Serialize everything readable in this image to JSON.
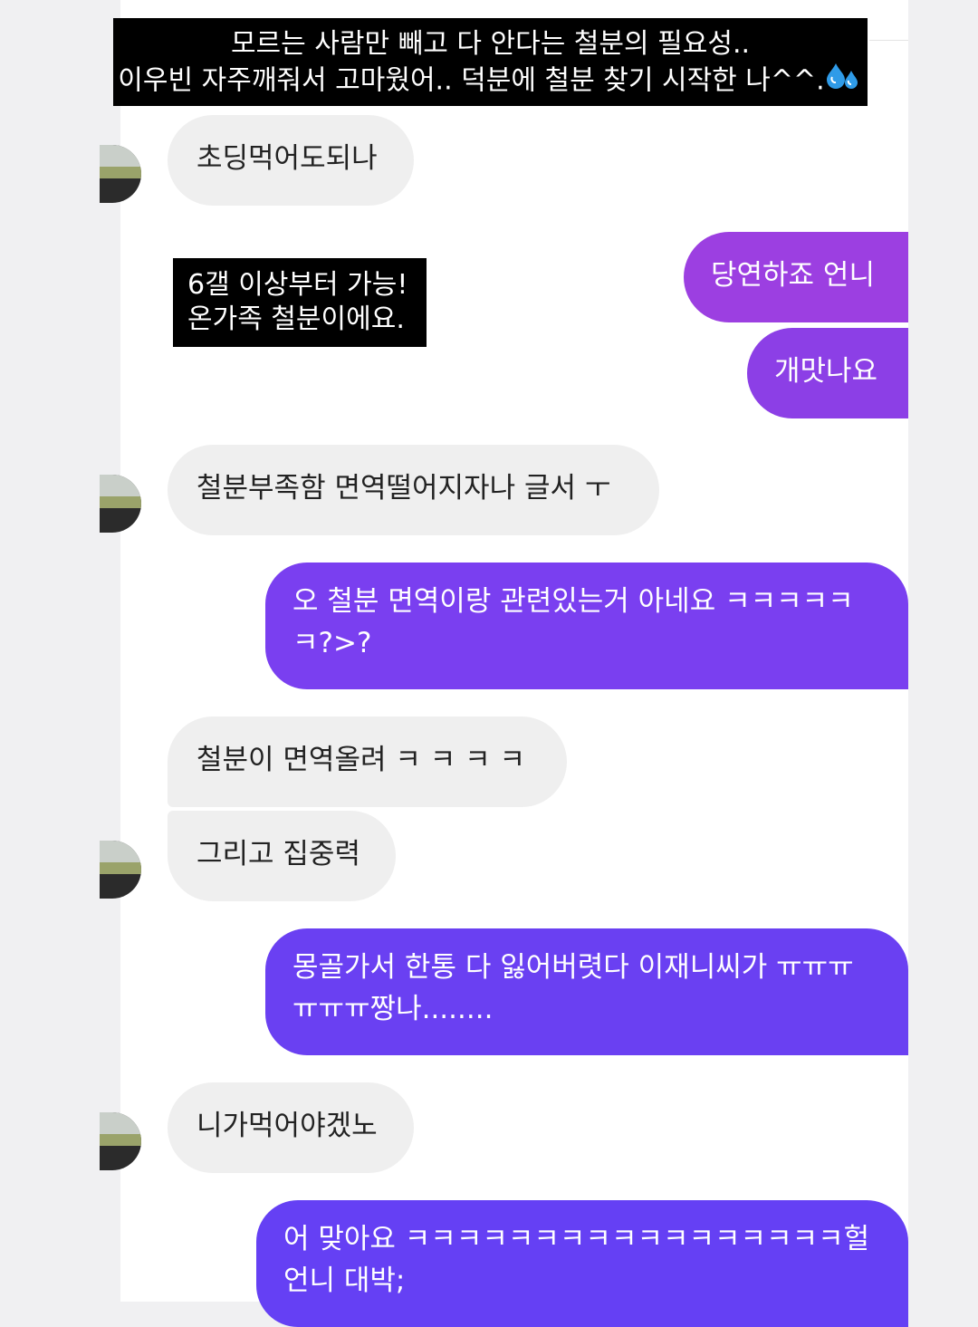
{
  "caption": {
    "line1": "모르는 사람만 빼고 다 안다는 철분의 필요성..",
    "line2": "이우빈 자주깨줘서 고마웠어.. 덕분에 철분 찾기 시작한 나^^.",
    "emoji": "sweat-droplets-icon"
  },
  "note": {
    "line1": "6갤 이상부터 가능!",
    "line2": "온가족 철분이에요."
  },
  "messages": {
    "m1": "초딩먹어도되나",
    "m2": "당연하죠 언니",
    "m3": "개맛나요",
    "m4": "철분부족함 면역떨어지자나 글서 ㅜ",
    "m5_line1": "오 철분 면역이랑 관련있는거 아네요 ㅋㅋㅋㅋㅋ",
    "m5_line2": "ㅋ?>?",
    "m6": "철분이 면역올려 ㅋ ㅋ ㅋ ㅋ",
    "m7": "그리고 집중력",
    "m8_line1": "몽골가서 한통 다 잃어버렷다 이재니씨가 ㅠㅠㅠ",
    "m8_line2": "ㅠㅠㅠ짱나........",
    "m9": "니가먹어야겠노",
    "m10_line1": "어 맞아요 ㅋㅋㅋㅋㅋㅋㅋㅋㅋㅋㅋㅋㅋㅋㅋㅋㅋ헐",
    "m10_line2": "언니 대박;"
  },
  "colors": {
    "incoming_bubble": "#efefef",
    "outgoing_gradient": [
      "#9c3fe1",
      "#8c3fe6",
      "#7a3ff0",
      "#6a40f2",
      "#6540f4"
    ],
    "overlay_bg": "#000000"
  }
}
